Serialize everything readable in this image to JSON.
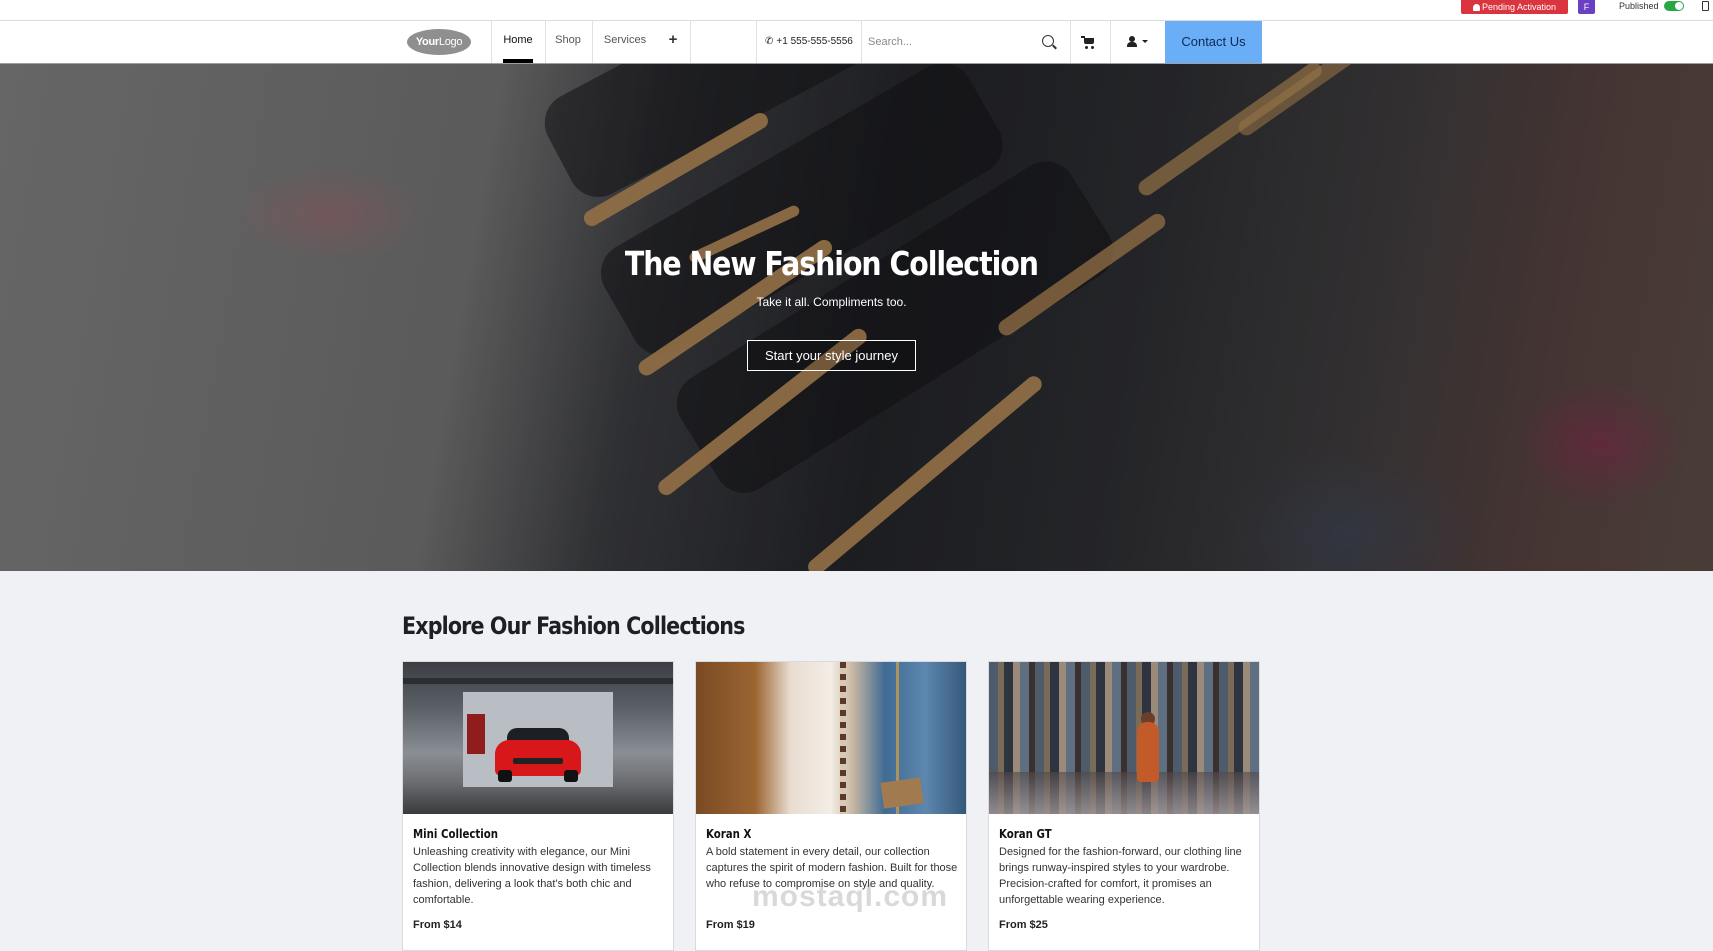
{
  "admin_bar": {
    "pending_label": "Pending Activation",
    "user_initial": "F",
    "published_label": "Published",
    "published_on": true
  },
  "header": {
    "logo_text_bold": "Your",
    "logo_text_light": "Logo",
    "nav": [
      {
        "label": "Home",
        "active": true
      },
      {
        "label": "Shop",
        "active": false
      },
      {
        "label": "Services",
        "active": false
      }
    ],
    "add_menu_glyph": "+",
    "phone": "+1 555-555-5556",
    "search_placeholder": "Search...",
    "contact_label": "Contact Us",
    "icons": [
      "phone-icon",
      "search-icon",
      "cart-icon",
      "user-icon",
      "chevron-down-icon"
    ],
    "accent_color": "#69aef6"
  },
  "hero": {
    "title": "The New Fashion Collection",
    "subtitle": "Take it all. Compliments too.",
    "cta_label": "Start your style journey"
  },
  "collections": {
    "title": "Explore Our Fashion Collections",
    "cards": [
      {
        "title": "Mini Collection",
        "description": "Unleashing creativity with elegance, our Mini Collection blends innovative design with timeless fashion, delivering a look that's both chic and comfortable.",
        "price": "From $14"
      },
      {
        "title": "Koran X",
        "description": "A bold statement in every detail, our collection captures the spirit of modern fashion. Built for those who refuse to compromise on style and quality.",
        "price": "From $19"
      },
      {
        "title": "Koran GT",
        "description": "Designed for the fashion-forward, our clothing line brings runway-inspired styles to your wardrobe. Precision-crafted for comfort, it promises an unforgettable wearing experience.",
        "price": "From $25"
      }
    ]
  },
  "watermark": "mostaql.com"
}
